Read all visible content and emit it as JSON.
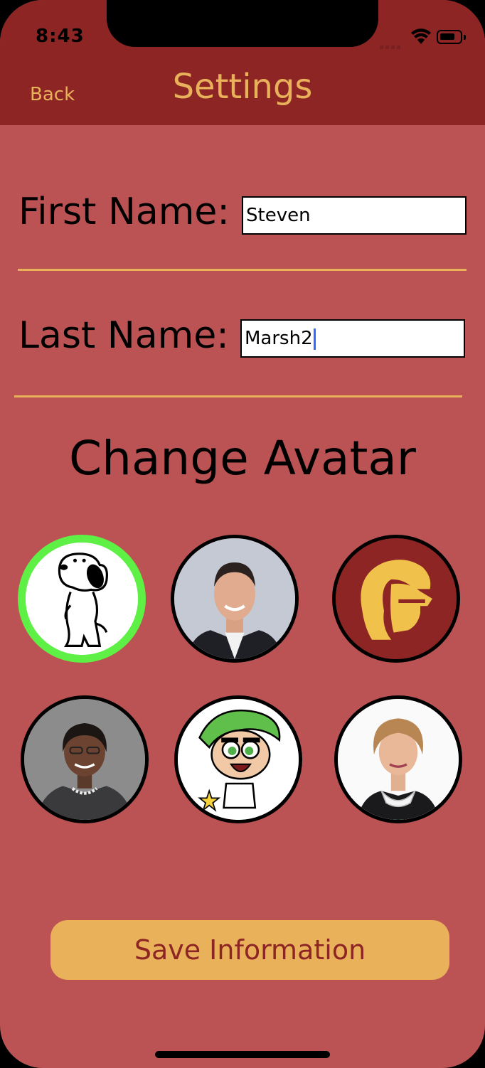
{
  "status_bar": {
    "time": "8:43"
  },
  "nav": {
    "back_label": "Back",
    "title": "Settings"
  },
  "form": {
    "first_name": {
      "label": "First Name:",
      "value": "Steven"
    },
    "last_name": {
      "label": "Last Name:",
      "value": "Marsh2"
    }
  },
  "avatars": {
    "title": "Change Avatar",
    "items": [
      {
        "name": "snoopy",
        "selected": true
      },
      {
        "name": "man-in-suit",
        "selected": false
      },
      {
        "name": "trojan-logo",
        "selected": false
      },
      {
        "name": "woman-in-blazer",
        "selected": false
      },
      {
        "name": "cartoon-character",
        "selected": false
      },
      {
        "name": "judge",
        "selected": false
      }
    ]
  },
  "save_button": {
    "label": "Save Information"
  },
  "colors": {
    "background": "#bb5354",
    "nav_background": "#8e2525",
    "accent": "#e8b15a",
    "selected_ring": "#5ef044"
  }
}
